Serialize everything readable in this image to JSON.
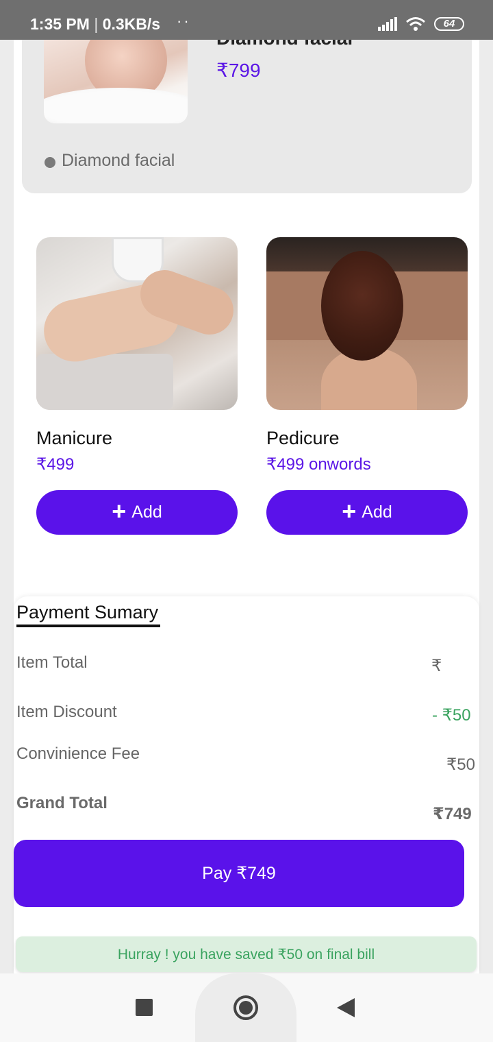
{
  "status_bar": {
    "time": "1:35 PM",
    "speed": "0.3KB/s",
    "dots": "··",
    "battery": "64"
  },
  "top_card": {
    "title": "Diamond facial",
    "price": "₹799",
    "label": "Diamond facial"
  },
  "products": [
    {
      "name": "Manicure",
      "price": "₹499",
      "button": "Add"
    },
    {
      "name": "Pedicure",
      "price": "₹499 onwords",
      "button": "Add"
    }
  ],
  "payment_summary": {
    "title": "Payment Sumary",
    "rows": [
      {
        "label": "Item Total",
        "value": "₹"
      },
      {
        "label": "Item Discount",
        "value": "- ₹50"
      },
      {
        "label": "Convinience Fee",
        "value": "₹50"
      },
      {
        "label": "Grand Total",
        "value": "₹749"
      }
    ],
    "pay_button": "Pay ₹749",
    "savings_banner": "Hurray ! you have saved ₹50 on final bill"
  },
  "colors": {
    "accent": "#5a12ea",
    "price": "#5b16e6",
    "saving": "#3aa35f"
  }
}
